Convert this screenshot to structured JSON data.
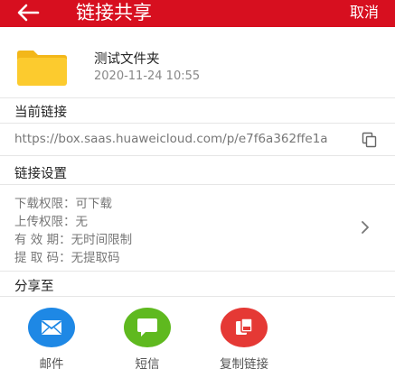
{
  "header": {
    "title": "链接共享",
    "cancel_label": "取消",
    "background_color": "#d70f1f",
    "back_icon": "back-arrow-icon"
  },
  "file": {
    "name": "测试文件夹",
    "date": "2020-11-24 10:55",
    "icon": "folder-icon",
    "icon_color": "#fbcb2c"
  },
  "current_link": {
    "title": "当前链接",
    "url": "https://box.saas.huaweicloud.com/p/e7f6a362ffe1a",
    "copy_icon": "copy-icon"
  },
  "link_settings": {
    "title": "链接设置",
    "lines": [
      "下载权限：可下载",
      "上传权限：无",
      "有  效  期：无时间限制",
      "提  取  码：无提取码"
    ],
    "chevron_icon": "chevron-right-icon"
  },
  "share_to": {
    "title": "分享至",
    "items": [
      {
        "label": "邮件",
        "icon": "mail-icon",
        "color": "#1e88e5"
      },
      {
        "label": "短信",
        "icon": "sms-icon",
        "color": "#5fb91f"
      },
      {
        "label": "复制链接",
        "icon": "copy-link-icon",
        "color": "#e53935"
      }
    ]
  }
}
